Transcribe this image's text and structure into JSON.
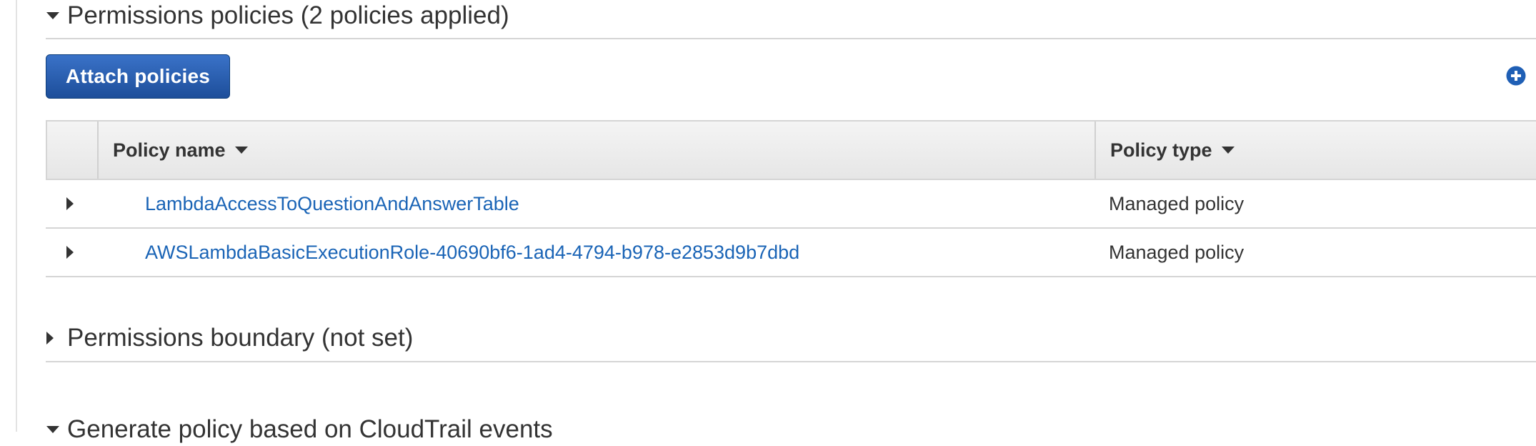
{
  "permissions_policies": {
    "title": "Permissions policies (2 policies applied)",
    "expanded": true,
    "attach_button_label": "Attach policies",
    "add_icon": "plus-circle-icon",
    "table": {
      "columns": [
        "Policy name",
        "Policy type"
      ],
      "rows": [
        {
          "name": "LambdaAccessToQuestionAndAnswerTable",
          "type": "Managed policy"
        },
        {
          "name": "AWSLambdaBasicExecutionRole-40690bf6-1ad4-4794-b978-e2853d9b7dbd",
          "type": "Managed policy"
        }
      ]
    }
  },
  "permissions_boundary": {
    "title": "Permissions boundary (not set)",
    "expanded": false
  },
  "generate_policy": {
    "title": "Generate policy based on CloudTrail events",
    "expanded": true
  },
  "colors": {
    "link": "#1a64b6",
    "button": "#1d4e9a",
    "text": "#333333",
    "header_bg": "#e6e6e6"
  }
}
